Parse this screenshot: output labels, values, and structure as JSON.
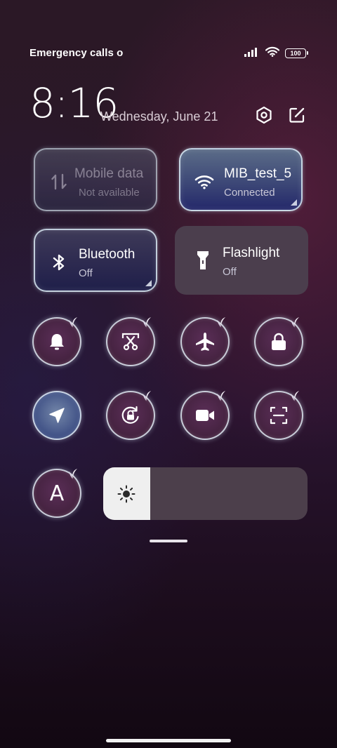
{
  "status_bar": {
    "carrier_text": "Emergency calls o",
    "battery_level": "100",
    "icons": [
      "signal-icon",
      "wifi-icon",
      "battery-icon"
    ]
  },
  "header": {
    "time": "8:16",
    "date": "Wednesday, June 21",
    "icons": [
      "settings-icon",
      "edit-icon"
    ]
  },
  "tiles": {
    "mobile_data": {
      "title": "Mobile data",
      "subtitle": "Not available",
      "icon": "data-transfer-icon"
    },
    "wifi": {
      "title": "MIB_test_5",
      "subtitle": "Connected",
      "icon": "wifi-icon"
    },
    "bluetooth": {
      "title": "Bluetooth",
      "subtitle": "Off",
      "icon": "bluetooth-icon"
    },
    "flashlight": {
      "title": "Flashlight",
      "subtitle": "Off",
      "icon": "flashlight-icon"
    }
  },
  "toggles_row1": [
    {
      "name": "notification-bell",
      "icon": "bell-icon"
    },
    {
      "name": "screenshot",
      "icon": "scissors-icon"
    },
    {
      "name": "airplane-mode",
      "icon": "airplane-icon"
    },
    {
      "name": "lock-screen",
      "icon": "lock-icon"
    }
  ],
  "toggles_row2": [
    {
      "name": "location",
      "icon": "location-arrow-icon",
      "active": true
    },
    {
      "name": "rotation-lock",
      "icon": "rotation-lock-icon"
    },
    {
      "name": "screen-recorder",
      "icon": "video-camera-icon"
    },
    {
      "name": "scanner",
      "icon": "scan-icon"
    }
  ],
  "auto_brightness": {
    "label": "A",
    "icon": "auto-brightness-icon"
  },
  "brightness": {
    "level": 0.23,
    "icon": "sun-icon"
  },
  "colors": {
    "wifi_tile": "#3d4877",
    "bluetooth_tile": "#2d2a50",
    "flashlight_tile": "#4b3e4d",
    "toggle_bg": "#44223f",
    "location_active": "#3e4f85",
    "brightness_fill": "#efefef"
  }
}
